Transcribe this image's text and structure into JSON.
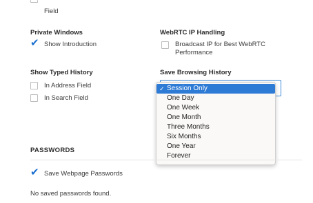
{
  "colors": {
    "accent": "#2e7bd6",
    "check": "#1a6fd1"
  },
  "top_partial": {
    "label": "Field"
  },
  "private_windows": {
    "heading": "Private Windows",
    "show_introduction": {
      "label": "Show Introduction",
      "checked": true
    }
  },
  "webrtc": {
    "heading": "WebRTC IP Handling",
    "broadcast": {
      "label_line1": "Broadcast IP for Best WebRTC",
      "label_line2": "Performance",
      "checked": false
    }
  },
  "typed_history": {
    "heading": "Show Typed History",
    "address_field": {
      "label": "In Address Field",
      "checked": false
    },
    "search_field": {
      "label": "In Search Field",
      "checked": false
    }
  },
  "browsing_history": {
    "heading": "Save Browsing History",
    "selected": "Session Only",
    "options": [
      "Session Only",
      "One Day",
      "One Week",
      "One Month",
      "Three Months",
      "Six Months",
      "One Year",
      "Forever"
    ]
  },
  "passwords": {
    "heading": "PASSWORDS",
    "save_passwords": {
      "label": "Save Webpage Passwords",
      "checked": true
    },
    "status": "No saved passwords found."
  },
  "icons": {
    "checkmark": "checkmark-icon",
    "selected_tick": "tick-icon"
  }
}
